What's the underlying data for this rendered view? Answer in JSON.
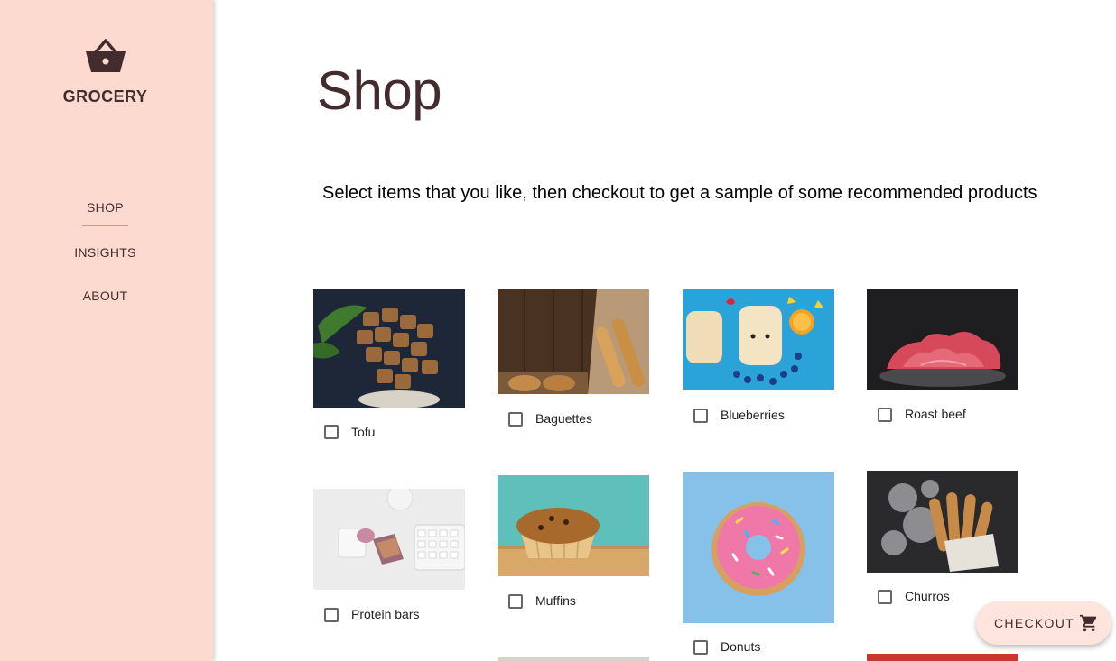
{
  "brand": {
    "title": "GROCERY",
    "icon": "basket-icon"
  },
  "nav": {
    "items": [
      {
        "label": "SHOP",
        "active": true
      },
      {
        "label": "INSIGHTS",
        "active": false
      },
      {
        "label": "ABOUT",
        "active": false
      }
    ]
  },
  "page": {
    "title": "Shop",
    "subtitle": "Select items that you like, then checkout to get a sample of some recommended products"
  },
  "products": [
    {
      "name": "Tofu",
      "checked": false
    },
    {
      "name": "Baguettes",
      "checked": false
    },
    {
      "name": "Blueberries",
      "checked": false
    },
    {
      "name": "Roast beef",
      "checked": false
    },
    {
      "name": "Protein bars",
      "checked": false
    },
    {
      "name": "Muffins",
      "checked": false
    },
    {
      "name": "Donuts",
      "checked": false
    },
    {
      "name": "Churros",
      "checked": false
    }
  ],
  "checkout": {
    "label": "CHECKOUT",
    "icon": "cart-icon"
  },
  "colors": {
    "sidebar": "#fcdad0",
    "accent": "#442c2e",
    "underline": "#e58c8a",
    "fab": "#fde4dc"
  }
}
